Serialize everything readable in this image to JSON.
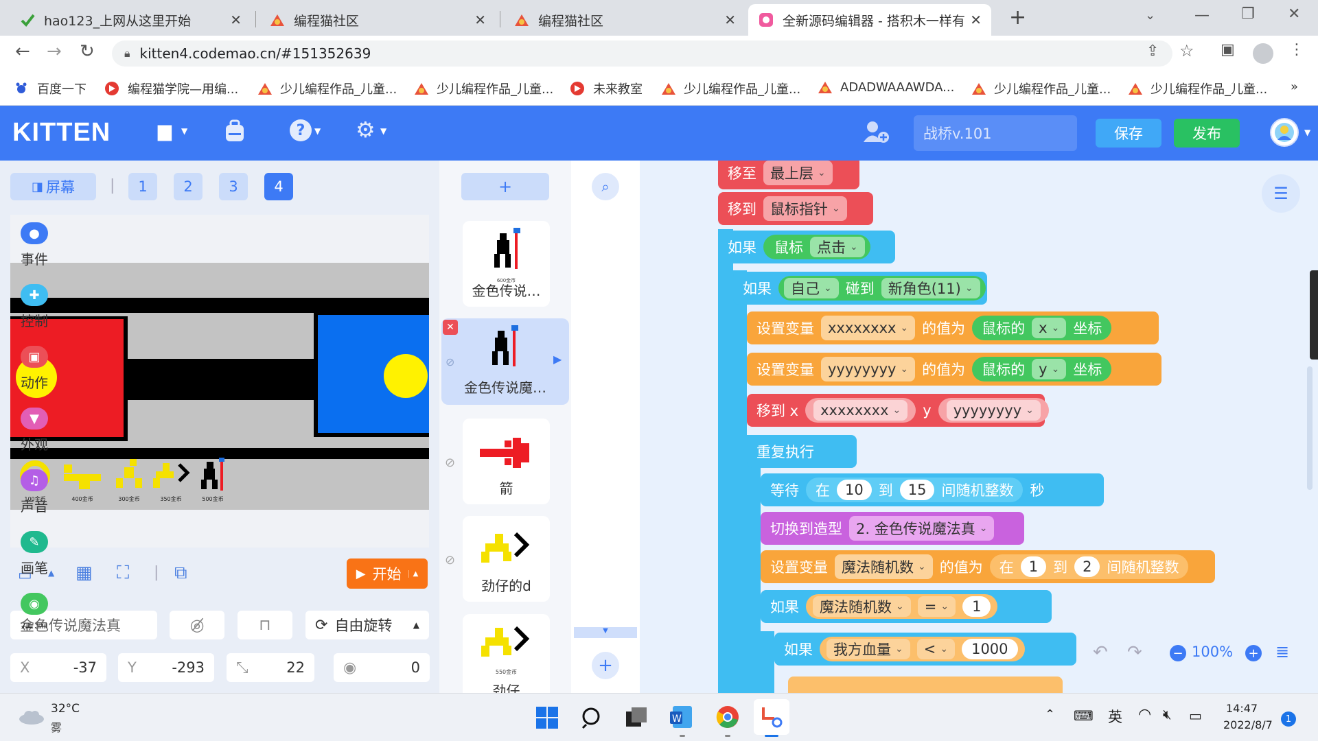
{
  "browser": {
    "tabs": [
      {
        "title": "hao123_上网从这里开始"
      },
      {
        "title": "编程猫社区"
      },
      {
        "title": "编程猫社区"
      },
      {
        "title": "全新源码编辑器 - 搭积木一样有趣"
      }
    ],
    "url": "kitten4.codemao.cn/#151352639",
    "bookmarks": [
      "百度一下",
      "编程猫学院—用编...",
      "少儿编程作品_儿童...",
      "少儿编程作品_儿童...",
      "未来教室",
      "少儿编程作品_儿童...",
      "ADADWAAAWDA...",
      "少儿编程作品_儿童...",
      "少儿编程作品_儿童..."
    ],
    "more": "»"
  },
  "header": {
    "logo": "KITTEN",
    "project_name": "战桥v.101",
    "save": "保存",
    "publish": "发布"
  },
  "stage": {
    "screen_label": "屏幕",
    "screens": [
      "1",
      "2",
      "3",
      "4"
    ],
    "active_screen": "4",
    "start_label": "开始",
    "hud_labels": [
      "100金币",
      "400金币",
      "300金币",
      "350金币",
      "500金币"
    ]
  },
  "props": {
    "sprite_name": "金色传说魔法真",
    "rotation": "自由旋转",
    "x_label": "X",
    "x": "-37",
    "y_label": "Y",
    "y": "-293",
    "size": "22",
    "direction": "0"
  },
  "sprites": {
    "add": "+",
    "items": [
      {
        "name": "金色传说…",
        "sub": "600金币"
      },
      {
        "name": "金色传说魔…",
        "sub": ""
      },
      {
        "name": "箭",
        "sub": ""
      },
      {
        "name": "劲仔的d",
        "sub": ""
      },
      {
        "name": "劲仔",
        "sub": "550金币"
      }
    ]
  },
  "categories": [
    {
      "name": "事件",
      "color": "#3d7af5"
    },
    {
      "name": "控制",
      "color": "#3fbdf2"
    },
    {
      "name": "动作",
      "color": "#ec4f57"
    },
    {
      "name": "外观",
      "color": "#e25eb5"
    },
    {
      "name": "声音",
      "color": "#b45ee6"
    },
    {
      "name": "画笔",
      "color": "#1fb98e"
    },
    {
      "name": "侦测",
      "color": "#43c75f"
    }
  ],
  "blocks": {
    "b1": {
      "t1": "移至",
      "d1": "最上层"
    },
    "b2": {
      "t1": "移到",
      "d1": "鼠标指针"
    },
    "b3": {
      "t1": "如果",
      "t2": "鼠标",
      "d1": "点击"
    },
    "b4": {
      "t1": "如果",
      "d1": "自己",
      "t2": "碰到",
      "d2": "新角色(11)"
    },
    "b5": {
      "t1": "设置变量",
      "d1": "xxxxxxxx",
      "t2": "的值为",
      "t3": "鼠标的",
      "d2": "x",
      "t4": "坐标"
    },
    "b6": {
      "t1": "设置变量",
      "d1": "yyyyyyyy",
      "t2": "的值为",
      "t3": "鼠标的",
      "d2": "y",
      "t4": "坐标"
    },
    "b7": {
      "t1": "移到 x",
      "d1": "xxxxxxxx",
      "t2": "y",
      "d2": "yyyyyyyy"
    },
    "b8": {
      "t1": "重复执行"
    },
    "b9": {
      "t1": "等待",
      "t2": "在",
      "v1": "10",
      "t3": "到",
      "v2": "15",
      "t4": "间随机整数",
      "t5": "秒"
    },
    "b10": {
      "t1": "切换到造型",
      "d1": "2. 金色传说魔法真"
    },
    "b11": {
      "t1": "设置变量",
      "d1": "魔法随机数",
      "t2": "的值为",
      "t3": "在",
      "v1": "1",
      "t4": "到",
      "v2": "2",
      "t5": "间随机整数"
    },
    "b12": {
      "t1": "如果",
      "d1": "魔法随机数",
      "d2": "=",
      "v1": "1"
    },
    "b13": {
      "t1": "如果",
      "d1": "我方血量",
      "d2": "<",
      "v1": "1000"
    }
  },
  "zoom": "100%",
  "taskbar": {
    "temp": "32°C",
    "weather": "雾",
    "ime": "英",
    "time": "14:47",
    "date": "2022/8/7",
    "badge": "1"
  }
}
